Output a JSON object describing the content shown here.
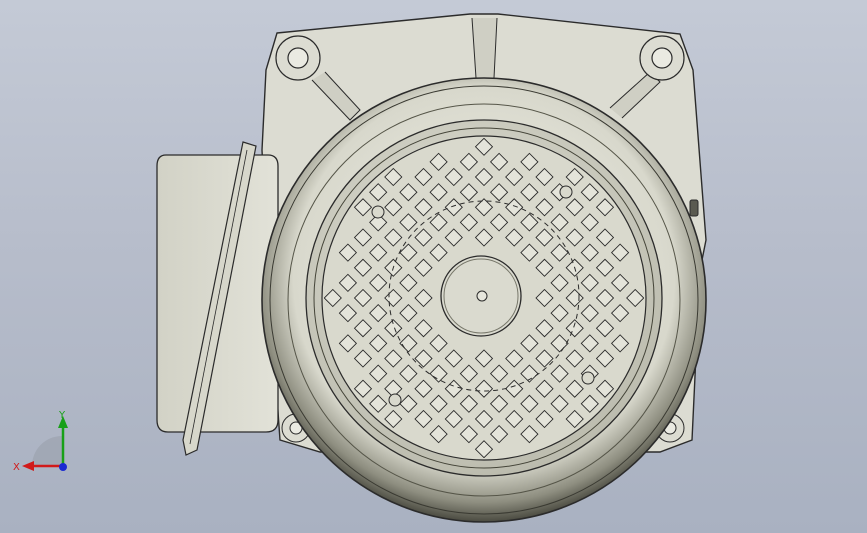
{
  "viewport": {
    "background_top": "#c4cad6",
    "background_bottom": "#a9b1c1",
    "model": {
      "body_color": "#dcdcd2",
      "outline_color": "#2b2b2b",
      "fan_cover_color": "#cfcfc3",
      "vent_grid_rows": 15,
      "vent_grid_cols": 15
    }
  },
  "triad": {
    "x_label": "X",
    "y_label": "Y",
    "x_color": "#d11a1a",
    "y_color": "#18a018",
    "z_color": "#1a2ad1"
  }
}
